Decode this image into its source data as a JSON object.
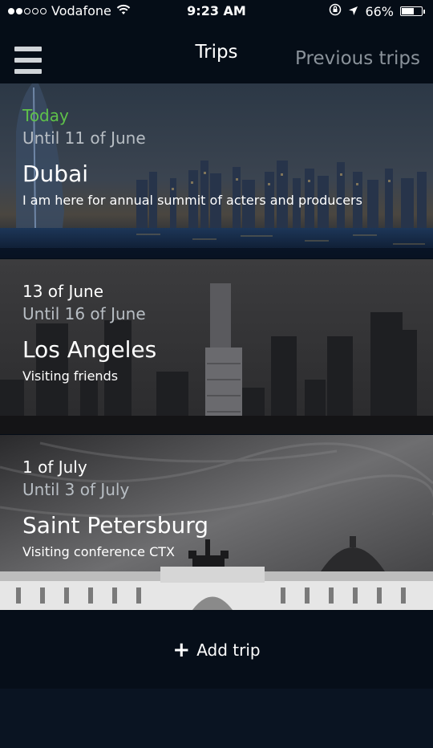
{
  "status": {
    "carrier": "Vodafone",
    "time": "9:23 AM",
    "battery_text": "66%",
    "battery_level": 0.66,
    "signal_bars_filled": 2,
    "signal_bars_total": 5
  },
  "nav": {
    "title": "Trips",
    "previous_label": "Previous trips"
  },
  "trips": [
    {
      "date": "Today",
      "until": "Until 11 of June",
      "city": "Dubai",
      "description": "I am here for annual summit of acters and producers",
      "date_color": "#5fc24a"
    },
    {
      "date": "13 of June",
      "until": "Until 16 of June",
      "city": "Los Angeles",
      "description": "Visiting friends"
    },
    {
      "date": "1 of July",
      "until": "Until 3 of July",
      "city": "Saint Petersburg",
      "description": "Visiting conference CTX"
    }
  ],
  "add_trip": {
    "label": "Add trip",
    "icon": "plus-icon"
  },
  "colors": {
    "background": "#050d17",
    "accent_green": "#5fc24a",
    "muted_text": "#8a929a"
  }
}
